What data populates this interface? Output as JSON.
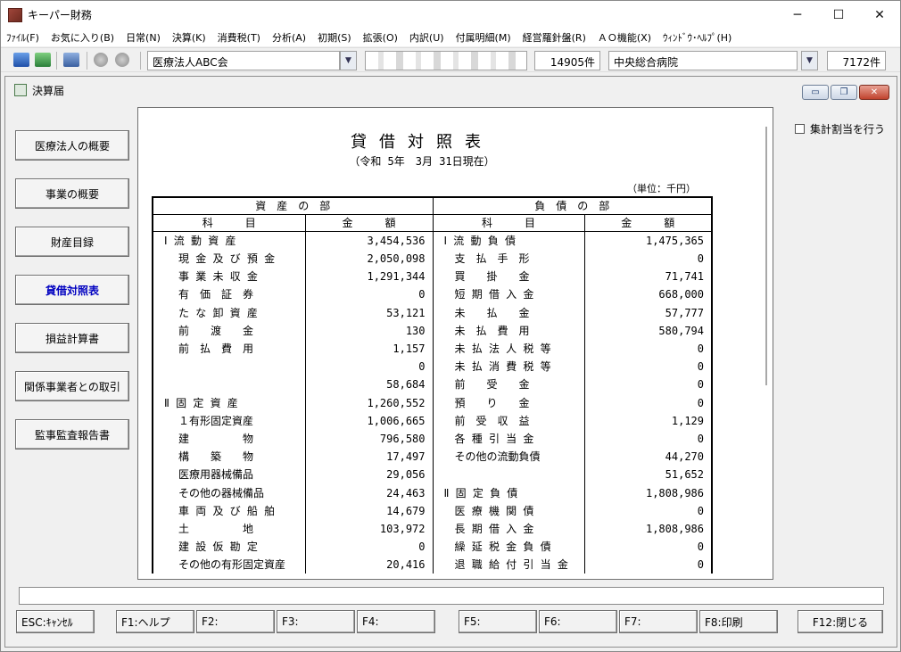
{
  "app": {
    "title": "キーパー財務"
  },
  "window_controls": {
    "minimize": "─",
    "maximize": "☐",
    "close": "✕"
  },
  "menu": [
    "ﾌｧｲﾙ(F)",
    "お気に入り(B)",
    "日常(N)",
    "決算(K)",
    "消費税(T)",
    "分析(A)",
    "初期(S)",
    "拡張(O)",
    "内訳(U)",
    "付属明細(M)",
    "経営羅針盤(R)",
    "ＡＯ機能(X)",
    "ｳｨﾝﾄﾞｳ･ﾍﾙﾌﾟ(H)"
  ],
  "toolbar": {
    "corporation": "医療法人ABC会",
    "blurred_field": "",
    "count1": "14905件",
    "hospital": "中央総合病院",
    "count2": "7172件"
  },
  "mdi": {
    "title": "決算届",
    "min": "▭",
    "restore": "❐",
    "close": "✕"
  },
  "sidebar": [
    "医療法人の概要",
    "事業の概要",
    "財産目録",
    "貸借対照表",
    "損益計算書",
    "関係事業者との取引",
    "監事監査報告書"
  ],
  "options": {
    "aggregate_label": "集計割当を行う"
  },
  "report": {
    "title": "貸借対照表",
    "date": "（令和 5年　3月 31日現在）",
    "unit": "（単位：千円）",
    "assets_header": "資　産　の　部",
    "liabilities_header": "負　債　の　部",
    "col_item": "科　　　目",
    "col_amount": "金　　　額",
    "rows": [
      {
        "a_item": "Ⅰ 流 動 資 産",
        "a_val": "3,454,536",
        "l_item": "Ⅰ 流 動 負 債",
        "l_val": "1,475,365"
      },
      {
        "a_item": "現 金 及 び 預 金",
        "a_val": "2,050,098",
        "l_item": "支　払　手　形",
        "l_val": "0"
      },
      {
        "a_item": "事 業 未 収 金",
        "a_val": "1,291,344",
        "l_item": "買　　掛　　金",
        "l_val": "71,741"
      },
      {
        "a_item": "有　価　証　券",
        "a_val": "0",
        "l_item": "短 期 借 入 金",
        "l_val": "668,000"
      },
      {
        "a_item": "た な 卸 資 産",
        "a_val": "53,121",
        "l_item": "未　　払　　金",
        "l_val": "57,777"
      },
      {
        "a_item": "前　　渡　　金",
        "a_val": "130",
        "l_item": "未　払　費　用",
        "l_val": "580,794"
      },
      {
        "a_item": "前　払　費　用",
        "a_val": "1,157",
        "l_item": "未 払 法 人 税 等",
        "l_val": "0"
      },
      {
        "a_item": "",
        "a_val": "0",
        "l_item": "未 払 消 費 税 等",
        "l_val": "0"
      },
      {
        "a_item": "",
        "a_val": "58,684",
        "l_item": "前　　受　　金",
        "l_val": "0"
      },
      {
        "a_item": "Ⅱ 固 定 資 産",
        "a_val": "1,260,552",
        "l_item": "預　　り　　金",
        "l_val": "0"
      },
      {
        "a_item": "１有形固定資産",
        "a_val": "1,006,665",
        "l_item": "前　受　収　益",
        "l_val": "1,129"
      },
      {
        "a_item": "建　　　　　物",
        "a_val": "796,580",
        "l_item": "各 種 引 当 金",
        "l_val": "0"
      },
      {
        "a_item": "構　　築　　物",
        "a_val": "17,497",
        "l_item": "その他の流動負債",
        "l_val": "44,270"
      },
      {
        "a_item": "医療用器械備品",
        "a_val": "29,056",
        "l_item": "",
        "l_val": "51,652"
      },
      {
        "a_item": "その他の器械備品",
        "a_val": "24,463",
        "l_item": "Ⅱ 固 定 負 債",
        "l_val": "1,808,986"
      },
      {
        "a_item": "車 両 及 び 船 舶",
        "a_val": "14,679",
        "l_item": "医 療 機 関 債",
        "l_val": "0"
      },
      {
        "a_item": "土　　　　　地",
        "a_val": "103,972",
        "l_item": "長 期 借 入 金",
        "l_val": "1,808,986"
      },
      {
        "a_item": "建 設 仮 勘 定",
        "a_val": "0",
        "l_item": "繰 延 税 金 負 債",
        "l_val": "0"
      },
      {
        "a_item": "その他の有形固定資産",
        "a_val": "20,416",
        "l_item": "退 職 給 付 引 当 金",
        "l_val": "0"
      }
    ]
  },
  "fkeys": [
    "ESC:ｷｬﾝｾﾙ",
    "F1:ヘルプ",
    "F2:",
    "F3:",
    "F4:",
    "F5:",
    "F6:",
    "F7:",
    "F8:印刷",
    "F12:閉じる"
  ]
}
